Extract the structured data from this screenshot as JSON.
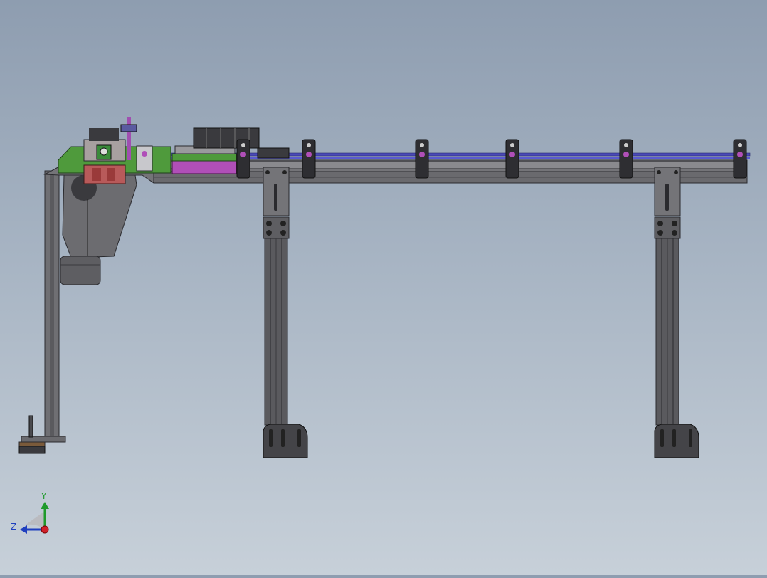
{
  "viewport": {
    "background_top": "#8e9db0",
    "background_bottom": "#c7d0d9"
  },
  "triad": {
    "y_label": "Y",
    "z_label": "Z",
    "y_color": "#1f9a2b",
    "z_color": "#1f3fbf",
    "x_color": "#d0202a"
  },
  "colors": {
    "frame": "#6f6f73",
    "frame_dark": "#3c3c40",
    "frame_light": "#8a8a8e",
    "green_plate": "#4f9a3c",
    "magenta_plate": "#b04fb8",
    "red_block": "#b85a5a",
    "blue_rail": "#4a4ab8",
    "clamp": "#2e2e32"
  },
  "assembly": {
    "clamp_count": 6,
    "leg_count": 2
  }
}
